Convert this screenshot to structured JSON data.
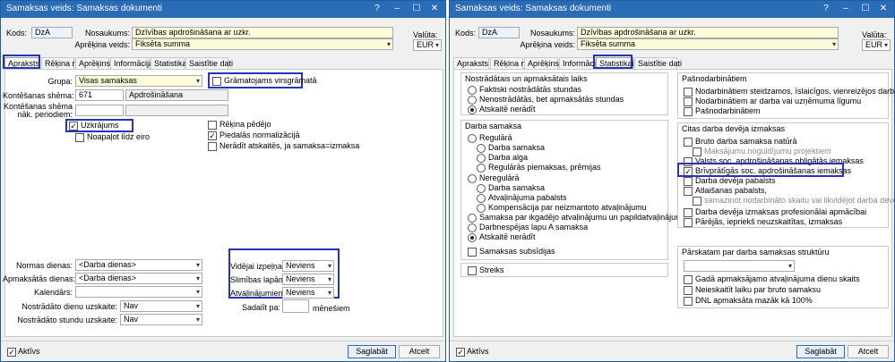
{
  "left": {
    "title": "Samaksas veids: Samaksas dokumenti",
    "labels": {
      "kods": "Kods:",
      "nosaukums": "Nosaukums:",
      "aprekina": "Aprēķina veids:",
      "valuta": "Valūta:"
    },
    "kods": "DzA",
    "nosaukums": "Dzīvības apdrošināšana ar uzkr.",
    "aprekina_veids": "Fiksēta summa",
    "valuta": "EUR",
    "tabs": [
      "Apraksts",
      "Rēķina no",
      "Aprēķins",
      "Informācija",
      "Statistikai",
      "Saistītie dati"
    ],
    "grupa_label": "Grupa:",
    "grupa": "Visas samaksas",
    "gramatojams": "Grāmatojams virsgrāmatā",
    "konts_label": "Kontēšanas shēma:",
    "konts_value": "671",
    "konts_name": "Apdrošināšana",
    "konts2_label_1": "Kontēšanas shēma",
    "konts2_label_2": "nāk. periodiem:",
    "uzkrajums": "Uzkrājums",
    "noapalot": "Noapaļot līdz eiro",
    "rekina_pedejo": "Rēķina pēdējo",
    "piedalas": "Piedalās normalizācijā",
    "neradit": "Nerādīt atskaitēs, ja samaksa=izmaksa",
    "normas_label": "Normas dienas:",
    "normas": "<Darba dienas>",
    "apmaksatas_label": "Apmaksātās dienas:",
    "apmaksatas": "<Darba dienas>",
    "kalendars_label": "Kalendārs:",
    "nostr_dienu_label": "Nostrādāto dienu uzskaite:",
    "nostr_dienu": "Nav",
    "nostr_stundu_label": "Nostrādāto stundu uzskaite:",
    "nostr_stundu": "Nav",
    "videjai_label": "Vidējai izpeļņai:",
    "videjai": "Neviens",
    "slimibas_label": "Slimības lapām:",
    "slimibas": "Neviens",
    "atvalinajumiem_label": "Atvaļinājumiem:",
    "atvalinajumiem": "Neviens",
    "sadalit_label": "Sadalīt pa:",
    "menesiem": "mēnešiem",
    "aktivs": "Aktīvs",
    "saglabat": "Saglabāt",
    "atcelt": "Atcelt"
  },
  "right": {
    "title": "Samaksas veids: Samaksas dokumenti",
    "labels": {
      "kods": "Kods:",
      "nosaukums": "Nosaukums:",
      "aprekina": "Aprēķina veids:",
      "valuta": "Valūta:"
    },
    "kods": "DzA",
    "nosaukums": "Dzīvības apdrošināšana ar uzkr.",
    "aprekina_veids": "Fiksēta summa",
    "valuta": "EUR",
    "tabs": [
      "Apraksts",
      "Rēķina no",
      "Aprēķins",
      "Informācija",
      "Statistikai",
      "Saistītie dati"
    ],
    "nostradatais_title": "Nostrādātais un apmaksātais laiks",
    "nostradatais": [
      "Faktiski nostrādātās stundas",
      "Nenostrādātās, bet apmaksātās stundas",
      "Atskaitē nerādīt"
    ],
    "darba_samaksa_title": "Darba samaksa",
    "regulara": "Regulārā",
    "regulara_items": [
      "Darba samaksa",
      "Darba alga",
      "Regulārās piemaksas, prēmijas"
    ],
    "neregulara": "Neregulārā",
    "neregulara_items": [
      "Darba samaksa",
      "Atvaļinājuma pabalsts",
      "Kompensācija par neizmantoto atvaļinājumu"
    ],
    "ds_rest": [
      "Samaksa par ikgadējo atvaļinājumu un papildatvaļinājumu",
      "Darbnespējas lapu A samaksa",
      "Atskaitē nerādīt"
    ],
    "samaksas_subsidijas": "Samaksas subsīdijas",
    "streiks": "Streiks",
    "pasnodarbinatiem_title": "Pašnodarbinātiem",
    "pasnodarbinatiem": [
      "Nodarbinātiem steidzamos, īslaicīgos, vienreizējos darbos",
      "Nodarbinātiem ar darba vai uzņēmuma līgumu",
      "Pašnodarbinātiem"
    ],
    "citas_title": "Citas darba devēja izmaksas",
    "bruto": "Bruto darba samaksa natūrā",
    "maksajumu": "Maksājumu noguldījumu projektiem",
    "valsts": "Valsts soc. apdrošināšanas obligātās iemaksas",
    "brivpratigas": "Brīvprātīgās soc. apdrošināšanas iemaksas",
    "darba_deveja_pabalsts": "Darba devēja pabalsts",
    "atlaisanas": "Atlaišanas pabalsts,",
    "samazinot": "samazinot nodarbināto skaitu vai likvidējot darba devēju",
    "profesionalai": "Darba devēja izmaksas profesionālai apmācībai",
    "parejas": "Pārējās, iepriekš neuzskaitītas, izmaksas",
    "parskatam_title": "Pārskatam par  darba samaksas struktūru",
    "parskatam_items": [
      "Gadā apmaksājamo atvaļinājuma dienu skaits",
      "Neieskaitīt laiku par bruto samaksu",
      "DNL apmaksāta mazāk kā 100%"
    ],
    "aktivs": "Aktīvs",
    "saglabat": "Saglabāt",
    "atcelt": "Atcelt"
  }
}
